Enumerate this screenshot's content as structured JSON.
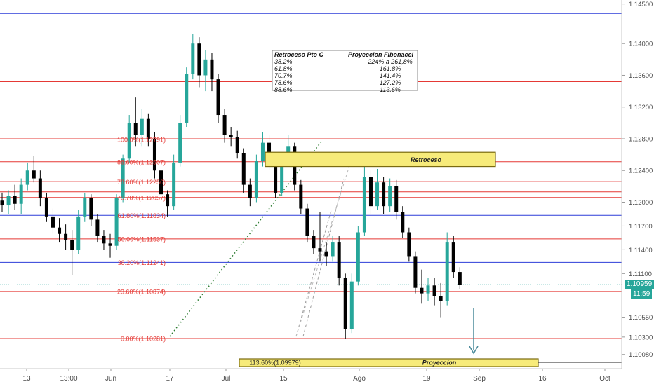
{
  "chart_data": {
    "type": "candlestick",
    "instrument_hint": "EURUSD",
    "x_ticks": [
      "13",
      "13:00",
      "Jun",
      "17",
      "Jul",
      "15",
      "Ago",
      "19",
      "Sep",
      "16",
      "Oct"
    ],
    "y_ticks": [
      "1.14500",
      "1.14000",
      "1.13600",
      "1.13200",
      "1.12800",
      "1.12400",
      "1.12000",
      "1.11700",
      "1.11400",
      "1.11100",
      "1.10550",
      "1.10300",
      "1.10080"
    ],
    "ylim": [
      1.0985,
      1.1465
    ],
    "current_price": {
      "value": 1.10959,
      "label": "1.10959",
      "timer": "11:59",
      "color": "#26a69a"
    },
    "horizontal_lines": [
      {
        "price": 1.1438,
        "color": "#2d3dd8"
      },
      {
        "price": 1.1352,
        "color": "#e53935"
      },
      {
        "price": 1.128,
        "color": "#e53935"
      },
      {
        "price": 1.1251,
        "color": "#e53935"
      },
      {
        "price": 1.1226,
        "color": "#e53935"
      },
      {
        "price": 1.1213,
        "color": "#e53935"
      },
      {
        "price": 1.1206,
        "color": "#e53935"
      },
      {
        "price": 1.11834,
        "color": "#2d3dd8"
      },
      {
        "price": 1.11537,
        "color": "#e53935"
      },
      {
        "price": 1.11241,
        "color": "#2d3dd8"
      },
      {
        "price": 1.10874,
        "color": "#e53935"
      },
      {
        "price": 1.10281,
        "color": "#e53935"
      }
    ],
    "fib_levels": [
      {
        "label": "100.0%(1.12791)",
        "price": 1.12791
      },
      {
        "label": "88.60%(1.12507)",
        "price": 1.12507
      },
      {
        "label": "78.60%(1.12256)",
        "price": 1.12256
      },
      {
        "label": "70.70%(1.12057)",
        "price": 1.12057
      },
      {
        "label": "61.80%(1.11834)",
        "price": 1.11834
      },
      {
        "label": "50.00%(1.11537)",
        "price": 1.11537
      },
      {
        "label": "38.20%(1.11241)",
        "price": 1.11241
      },
      {
        "label": "23.60%(1.10874)",
        "price": 1.10874
      },
      {
        "label": "0.00%(1.10281)",
        "price": 1.10281
      }
    ],
    "series": [
      {
        "x": 0.0,
        "o": 1.1202,
        "h": 1.1212,
        "l": 1.1188,
        "c": 1.1196
      },
      {
        "x": 0.6,
        "o": 1.1196,
        "h": 1.1215,
        "l": 1.1185,
        "c": 1.1208
      },
      {
        "x": 1.2,
        "o": 1.1208,
        "h": 1.1222,
        "l": 1.119,
        "c": 1.1198
      },
      {
        "x": 1.8,
        "o": 1.1198,
        "h": 1.123,
        "l": 1.1185,
        "c": 1.1222
      },
      {
        "x": 2.4,
        "o": 1.1222,
        "h": 1.125,
        "l": 1.1215,
        "c": 1.124
      },
      {
        "x": 3.0,
        "o": 1.124,
        "h": 1.1258,
        "l": 1.1225,
        "c": 1.123
      },
      {
        "x": 3.6,
        "o": 1.123,
        "h": 1.124,
        "l": 1.1195,
        "c": 1.1205
      },
      {
        "x": 4.2,
        "o": 1.1205,
        "h": 1.1212,
        "l": 1.1175,
        "c": 1.1182
      },
      {
        "x": 4.8,
        "o": 1.1182,
        "h": 1.1192,
        "l": 1.116,
        "c": 1.1168
      },
      {
        "x": 5.4,
        "o": 1.1168,
        "h": 1.118,
        "l": 1.115,
        "c": 1.116
      },
      {
        "x": 6.0,
        "o": 1.116,
        "h": 1.1172,
        "l": 1.114,
        "c": 1.1152
      },
      {
        "x": 6.6,
        "o": 1.1152,
        "h": 1.1165,
        "l": 1.1108,
        "c": 1.114
      },
      {
        "x": 7.2,
        "o": 1.114,
        "h": 1.119,
        "l": 1.1135,
        "c": 1.1182
      },
      {
        "x": 7.8,
        "o": 1.1182,
        "h": 1.1212,
        "l": 1.1175,
        "c": 1.1205
      },
      {
        "x": 8.4,
        "o": 1.1205,
        "h": 1.121,
        "l": 1.117,
        "c": 1.1178
      },
      {
        "x": 9.0,
        "o": 1.1178,
        "h": 1.1185,
        "l": 1.115,
        "c": 1.1158
      },
      {
        "x": 9.6,
        "o": 1.1158,
        "h": 1.1165,
        "l": 1.114,
        "c": 1.1148
      },
      {
        "x": 10.2,
        "o": 1.1148,
        "h": 1.116,
        "l": 1.113,
        "c": 1.1145
      },
      {
        "x": 10.8,
        "o": 1.1145,
        "h": 1.121,
        "l": 1.114,
        "c": 1.1205
      },
      {
        "x": 11.4,
        "o": 1.1205,
        "h": 1.126,
        "l": 1.12,
        "c": 1.1255
      },
      {
        "x": 12.0,
        "o": 1.1255,
        "h": 1.131,
        "l": 1.125,
        "c": 1.13
      },
      {
        "x": 12.6,
        "o": 1.13,
        "h": 1.1332,
        "l": 1.127,
        "c": 1.1285
      },
      {
        "x": 13.2,
        "o": 1.1285,
        "h": 1.1318,
        "l": 1.127,
        "c": 1.1305
      },
      {
        "x": 13.8,
        "o": 1.1305,
        "h": 1.1312,
        "l": 1.127,
        "c": 1.128
      },
      {
        "x": 14.4,
        "o": 1.128,
        "h": 1.1288,
        "l": 1.123,
        "c": 1.124
      },
      {
        "x": 15.0,
        "o": 1.124,
        "h": 1.1248,
        "l": 1.12,
        "c": 1.121
      },
      {
        "x": 15.6,
        "o": 1.121,
        "h": 1.1215,
        "l": 1.1182,
        "c": 1.1195
      },
      {
        "x": 16.2,
        "o": 1.1195,
        "h": 1.126,
        "l": 1.119,
        "c": 1.125
      },
      {
        "x": 16.8,
        "o": 1.125,
        "h": 1.131,
        "l": 1.1245,
        "c": 1.13
      },
      {
        "x": 17.4,
        "o": 1.13,
        "h": 1.137,
        "l": 1.1295,
        "c": 1.1362
      },
      {
        "x": 18.0,
        "o": 1.1362,
        "h": 1.1412,
        "l": 1.1355,
        "c": 1.14
      },
      {
        "x": 18.6,
        "o": 1.14,
        "h": 1.1408,
        "l": 1.1345,
        "c": 1.136
      },
      {
        "x": 19.2,
        "o": 1.136,
        "h": 1.1392,
        "l": 1.134,
        "c": 1.138
      },
      {
        "x": 19.8,
        "o": 1.138,
        "h": 1.1388,
        "l": 1.134,
        "c": 1.1355
      },
      {
        "x": 20.4,
        "o": 1.1355,
        "h": 1.1362,
        "l": 1.13,
        "c": 1.131
      },
      {
        "x": 21.0,
        "o": 1.131,
        "h": 1.1318,
        "l": 1.1275,
        "c": 1.1285
      },
      {
        "x": 21.6,
        "o": 1.1285,
        "h": 1.1295,
        "l": 1.127,
        "c": 1.1282
      },
      {
        "x": 22.2,
        "o": 1.1282,
        "h": 1.129,
        "l": 1.1255,
        "c": 1.1262
      },
      {
        "x": 22.8,
        "o": 1.1262,
        "h": 1.1268,
        "l": 1.1212,
        "c": 1.1222
      },
      {
        "x": 23.4,
        "o": 1.1222,
        "h": 1.123,
        "l": 1.1195,
        "c": 1.1205
      },
      {
        "x": 24.0,
        "o": 1.1205,
        "h": 1.126,
        "l": 1.12,
        "c": 1.1252
      },
      {
        "x": 24.6,
        "o": 1.1252,
        "h": 1.1288,
        "l": 1.1245,
        "c": 1.1275
      },
      {
        "x": 25.2,
        "o": 1.1275,
        "h": 1.1285,
        "l": 1.124,
        "c": 1.125
      },
      {
        "x": 25.8,
        "o": 1.125,
        "h": 1.1258,
        "l": 1.1205,
        "c": 1.1212
      },
      {
        "x": 26.4,
        "o": 1.1212,
        "h": 1.126,
        "l": 1.1208,
        "c": 1.125
      },
      {
        "x": 27.0,
        "o": 1.125,
        "h": 1.1285,
        "l": 1.1245,
        "c": 1.127
      },
      {
        "x": 27.6,
        "o": 1.127,
        "h": 1.1275,
        "l": 1.1215,
        "c": 1.1222
      },
      {
        "x": 28.2,
        "o": 1.1222,
        "h": 1.1228,
        "l": 1.1185,
        "c": 1.1192
      },
      {
        "x": 28.8,
        "o": 1.1192,
        "h": 1.1198,
        "l": 1.115,
        "c": 1.1158
      },
      {
        "x": 29.4,
        "o": 1.1158,
        "h": 1.1165,
        "l": 1.1135,
        "c": 1.1142
      },
      {
        "x": 30.0,
        "o": 1.1142,
        "h": 1.1188,
        "l": 1.1125,
        "c": 1.1138
      },
      {
        "x": 30.6,
        "o": 1.1138,
        "h": 1.115,
        "l": 1.112,
        "c": 1.1132
      },
      {
        "x": 31.2,
        "o": 1.1132,
        "h": 1.1158,
        "l": 1.1125,
        "c": 1.115
      },
      {
        "x": 31.8,
        "o": 1.115,
        "h": 1.1158,
        "l": 1.1095,
        "c": 1.1105
      },
      {
        "x": 32.4,
        "o": 1.1105,
        "h": 1.111,
        "l": 1.1028,
        "c": 1.104
      },
      {
        "x": 33.0,
        "o": 1.104,
        "h": 1.111,
        "l": 1.1035,
        "c": 1.11
      },
      {
        "x": 33.6,
        "o": 1.11,
        "h": 1.117,
        "l": 1.1095,
        "c": 1.1162
      },
      {
        "x": 34.2,
        "o": 1.1162,
        "h": 1.125,
        "l": 1.1158,
        "c": 1.1232
      },
      {
        "x": 34.8,
        "o": 1.1232,
        "h": 1.124,
        "l": 1.1185,
        "c": 1.1195
      },
      {
        "x": 35.4,
        "o": 1.1195,
        "h": 1.1242,
        "l": 1.119,
        "c": 1.1225
      },
      {
        "x": 36.0,
        "o": 1.1225,
        "h": 1.1232,
        "l": 1.1185,
        "c": 1.1195
      },
      {
        "x": 36.6,
        "o": 1.1195,
        "h": 1.123,
        "l": 1.1188,
        "c": 1.122
      },
      {
        "x": 37.2,
        "o": 1.122,
        "h": 1.1228,
        "l": 1.1178,
        "c": 1.1188
      },
      {
        "x": 37.8,
        "o": 1.1188,
        "h": 1.1195,
        "l": 1.1155,
        "c": 1.1162
      },
      {
        "x": 38.4,
        "o": 1.1162,
        "h": 1.1168,
        "l": 1.1125,
        "c": 1.1132
      },
      {
        "x": 39.0,
        "o": 1.1132,
        "h": 1.1138,
        "l": 1.1085,
        "c": 1.1092
      },
      {
        "x": 39.6,
        "o": 1.1092,
        "h": 1.1115,
        "l": 1.1072,
        "c": 1.1085
      },
      {
        "x": 40.2,
        "o": 1.1085,
        "h": 1.1105,
        "l": 1.1075,
        "c": 1.1095
      },
      {
        "x": 40.8,
        "o": 1.1095,
        "h": 1.1105,
        "l": 1.107,
        "c": 1.1082
      },
      {
        "x": 41.4,
        "o": 1.1082,
        "h": 1.1098,
        "l": 1.1055,
        "c": 1.1075
      },
      {
        "x": 42.0,
        "o": 1.1075,
        "h": 1.1162,
        "l": 1.107,
        "c": 1.115
      },
      {
        "x": 42.6,
        "o": 1.115,
        "h": 1.1158,
        "l": 1.1105,
        "c": 1.1112
      },
      {
        "x": 43.2,
        "o": 1.1112,
        "h": 1.1118,
        "l": 1.109,
        "c": 1.1096
      }
    ],
    "annotations": [
      {
        "text": "Retroceso",
        "type": "box",
        "price_top": 1.1263,
        "price_bottom": 1.1245
      },
      {
        "text": "Proyeccion",
        "type": "box",
        "price_top": 1.0997,
        "price_bottom": 1.0989
      },
      {
        "text": "113.60%(1.09979)",
        "type": "label"
      }
    ],
    "info_table": {
      "headers": [
        "Retroceso Pto C",
        "Proyeccion Fibonacci"
      ],
      "rows": [
        [
          "38.2%",
          "224% a 261,8%"
        ],
        [
          "61.8%",
          "161.8%"
        ],
        [
          "70.7%",
          "141.4%"
        ],
        [
          "78.6%",
          "127.2%"
        ],
        [
          "88.6%",
          "113.6%"
        ]
      ]
    },
    "colors": {
      "up": "#26a69a",
      "down": "#000000",
      "axis_text": "#4a4a4a",
      "annotation_fill": "#f7eb7a",
      "annotation_border": "#7a6a10",
      "fib_text": "#e53935",
      "arrow": "#4a8a9a"
    }
  }
}
